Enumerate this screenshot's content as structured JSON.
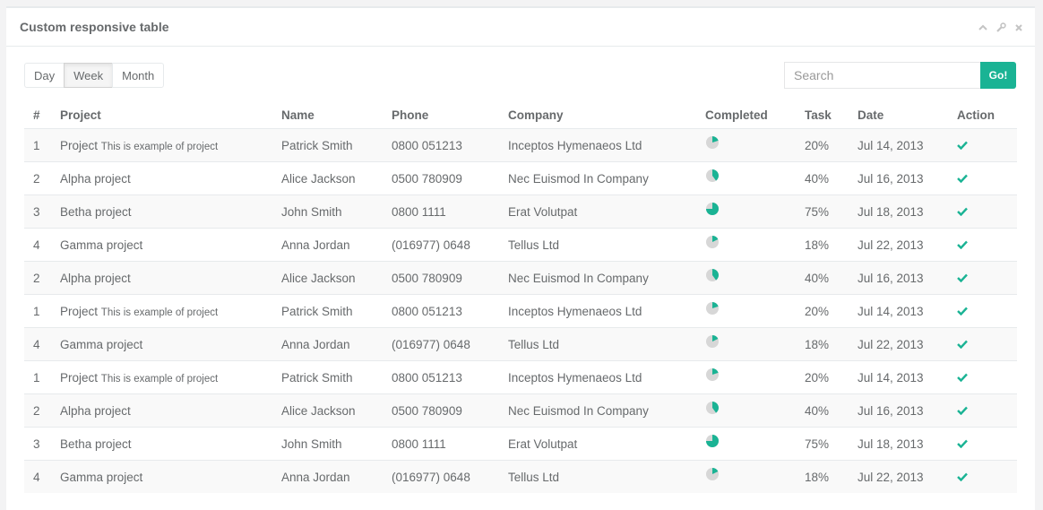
{
  "panel": {
    "title": "Custom responsive table"
  },
  "toolbar": {
    "day_label": "Day",
    "week_label": "Week",
    "month_label": "Month",
    "active": "Week"
  },
  "search": {
    "placeholder": "Search",
    "button_label": "Go!"
  },
  "colors": {
    "accent": "#1ab394",
    "pie_bg": "#d7d7d7"
  },
  "table": {
    "headers": [
      "#",
      "Project",
      "Name",
      "Phone",
      "Company",
      "Completed",
      "Task",
      "Date",
      "Action"
    ],
    "rows": [
      {
        "num": "1",
        "project": "Project",
        "project_note": "This is example of project",
        "name": "Patrick Smith",
        "phone": "0800 051213",
        "company": "Inceptos Hymenaeos Ltd",
        "completed": 0.2,
        "task": "20%",
        "date": "Jul 14, 2013"
      },
      {
        "num": "2",
        "project": "Alpha project",
        "project_note": "",
        "name": "Alice Jackson",
        "phone": "0500 780909",
        "company": "Nec Euismod In Company",
        "completed": 0.4,
        "task": "40%",
        "date": "Jul 16, 2013"
      },
      {
        "num": "3",
        "project": "Betha project",
        "project_note": "",
        "name": "John Smith",
        "phone": "0800 1111",
        "company": "Erat Volutpat",
        "completed": 0.75,
        "task": "75%",
        "date": "Jul 18, 2013"
      },
      {
        "num": "4",
        "project": "Gamma project",
        "project_note": "",
        "name": "Anna Jordan",
        "phone": "(016977) 0648",
        "company": "Tellus Ltd",
        "completed": 0.18,
        "task": "18%",
        "date": "Jul 22, 2013"
      },
      {
        "num": "2",
        "project": "Alpha project",
        "project_note": "",
        "name": "Alice Jackson",
        "phone": "0500 780909",
        "company": "Nec Euismod In Company",
        "completed": 0.4,
        "task": "40%",
        "date": "Jul 16, 2013"
      },
      {
        "num": "1",
        "project": "Project",
        "project_note": "This is example of project",
        "name": "Patrick Smith",
        "phone": "0800 051213",
        "company": "Inceptos Hymenaeos Ltd",
        "completed": 0.2,
        "task": "20%",
        "date": "Jul 14, 2013"
      },
      {
        "num": "4",
        "project": "Gamma project",
        "project_note": "",
        "name": "Anna Jordan",
        "phone": "(016977) 0648",
        "company": "Tellus Ltd",
        "completed": 0.18,
        "task": "18%",
        "date": "Jul 22, 2013"
      },
      {
        "num": "1",
        "project": "Project",
        "project_note": "This is example of project",
        "name": "Patrick Smith",
        "phone": "0800 051213",
        "company": "Inceptos Hymenaeos Ltd",
        "completed": 0.2,
        "task": "20%",
        "date": "Jul 14, 2013"
      },
      {
        "num": "2",
        "project": "Alpha project",
        "project_note": "",
        "name": "Alice Jackson",
        "phone": "0500 780909",
        "company": "Nec Euismod In Company",
        "completed": 0.4,
        "task": "40%",
        "date": "Jul 16, 2013"
      },
      {
        "num": "3",
        "project": "Betha project",
        "project_note": "",
        "name": "John Smith",
        "phone": "0800 1111",
        "company": "Erat Volutpat",
        "completed": 0.75,
        "task": "75%",
        "date": "Jul 18, 2013"
      },
      {
        "num": "4",
        "project": "Gamma project",
        "project_note": "",
        "name": "Anna Jordan",
        "phone": "(016977) 0648",
        "company": "Tellus Ltd",
        "completed": 0.18,
        "task": "18%",
        "date": "Jul 22, 2013"
      }
    ]
  }
}
